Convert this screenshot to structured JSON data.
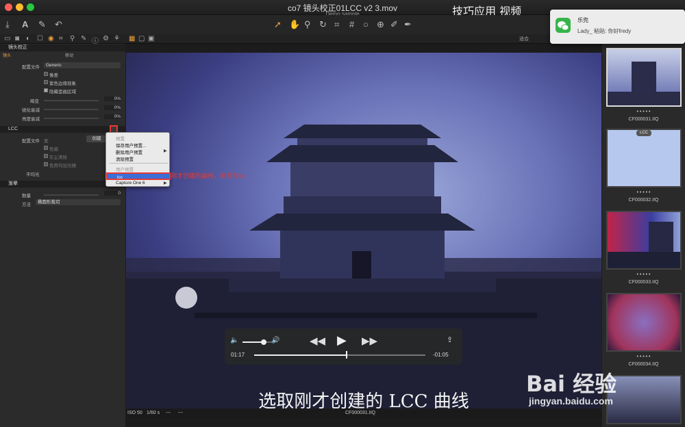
{
  "window": {
    "title": "co7 镜头校正01LCC v2 3.mov",
    "document": "Demo sample",
    "overlay_heading": "技巧应用 视频"
  },
  "toolbar2": {
    "right_label": "适合"
  },
  "left_panel": {
    "lens_section": {
      "title": "镜头校正",
      "tabs": [
        "镜头",
        "移动"
      ],
      "profile_label": "配置文件",
      "profile_value": "Generic",
      "checkboxes": [
        "像差",
        "紫色边缘现象",
        "隐藏歪曲区域"
      ],
      "sliders": [
        {
          "label": "畸变",
          "value": "0%"
        },
        {
          "label": "锐化衰减",
          "value": "0%"
        },
        {
          "label": "亮度衰减",
          "value": "0%"
        }
      ]
    },
    "lcc_section": {
      "title": "LCC",
      "profile_label": "配置文件",
      "profile_value": "无",
      "create_label": "创建",
      "checkboxes": [
        "色偏",
        "灰尘清除",
        "色用均加光栅"
      ],
      "uniform_label": "平均光"
    },
    "vignette_section": {
      "title": "渐晕",
      "amount_label": "数量",
      "amount_value": "0",
      "method_label": "方法",
      "method_value": "椭圆形裁切"
    }
  },
  "context_menu": {
    "header": "预置",
    "items": [
      "保存用户预置...",
      "删除用户预置",
      "清除预置"
    ],
    "group_label": "用户预置",
    "selected_item": "lcc",
    "last_item": "Capture One 6"
  },
  "annotation": "刚才创建的曲线，命名为lcc",
  "player": {
    "elapsed": "01:17",
    "remaining": "-01:05",
    "progress": 0.54,
    "volume": 0.7
  },
  "subtitle": "选取刚才创建的 LCC 曲线",
  "viewer_status": {
    "iso": "ISO 50",
    "shutter": "1/60 s",
    "aperture": "---",
    "extra": "---",
    "filename": "CF000031.IIQ"
  },
  "filmstrip": [
    {
      "name": "CF000031.IIQ",
      "dots": "• • • • •"
    },
    {
      "name": "CF000032.IIQ",
      "dots": "• • • • •",
      "badge": "LCC"
    },
    {
      "name": "CF000033.IIQ",
      "dots": "• • • • •"
    },
    {
      "name": "CF000034.IIQ",
      "dots": "• • • • •"
    }
  ],
  "notification": {
    "sender": "乐兜",
    "message": "Lady_ 粘贴: 你好fredy"
  },
  "watermark": {
    "brand": "Bai 经验",
    "url": "jingyan.baidu.com"
  },
  "colors": {
    "accent_red": "#e53935",
    "menu_highlight": "#3b6fd6"
  }
}
